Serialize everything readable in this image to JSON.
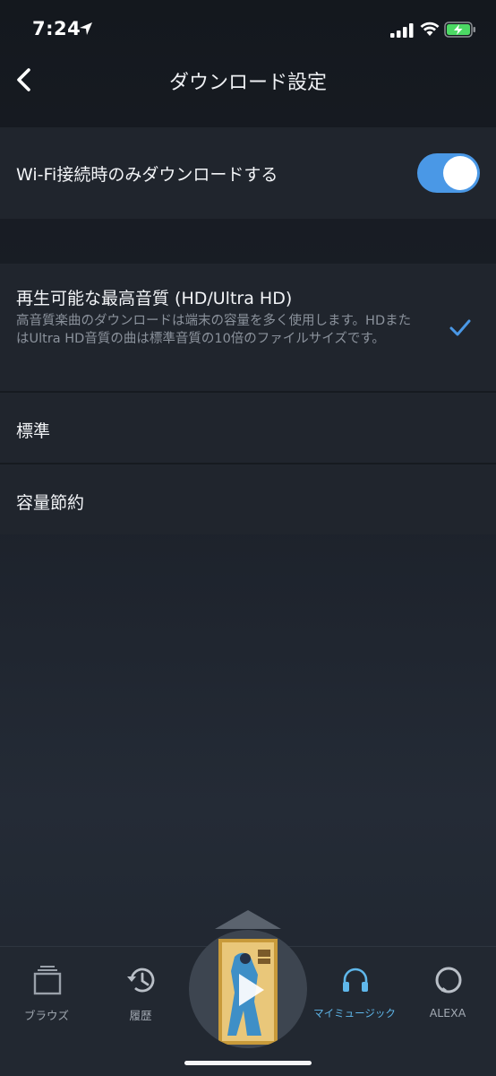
{
  "status_bar": {
    "time": "7:24"
  },
  "nav": {
    "title": "ダウンロード設定"
  },
  "settings": {
    "wifi_only": {
      "label": "Wi-Fi接続時のみダウンロードする",
      "enabled": true
    },
    "quality_options": [
      {
        "title": "再生可能な最高音質 (HD/Ultra HD)",
        "description": "高音質楽曲のダウンロードは端末の容量を多く使用します。HDまたはUltra HD音質の曲は標準音質の10倍のファイルサイズです。",
        "selected": true
      },
      {
        "title": "標準",
        "selected": false
      },
      {
        "title": "容量節約",
        "selected": false
      }
    ]
  },
  "tab_bar": {
    "tabs": [
      {
        "label": "ブラウズ",
        "icon": "browse-icon"
      },
      {
        "label": "履歴",
        "icon": "history-icon"
      },
      {
        "label": "マイミュージック",
        "icon": "headphones-icon",
        "active": true
      },
      {
        "label": "ALEXA",
        "icon": "alexa-icon"
      }
    ]
  },
  "colors": {
    "accent": "#4a98e6",
    "active_tab": "#5fb7ea",
    "background": "#1c212a"
  }
}
